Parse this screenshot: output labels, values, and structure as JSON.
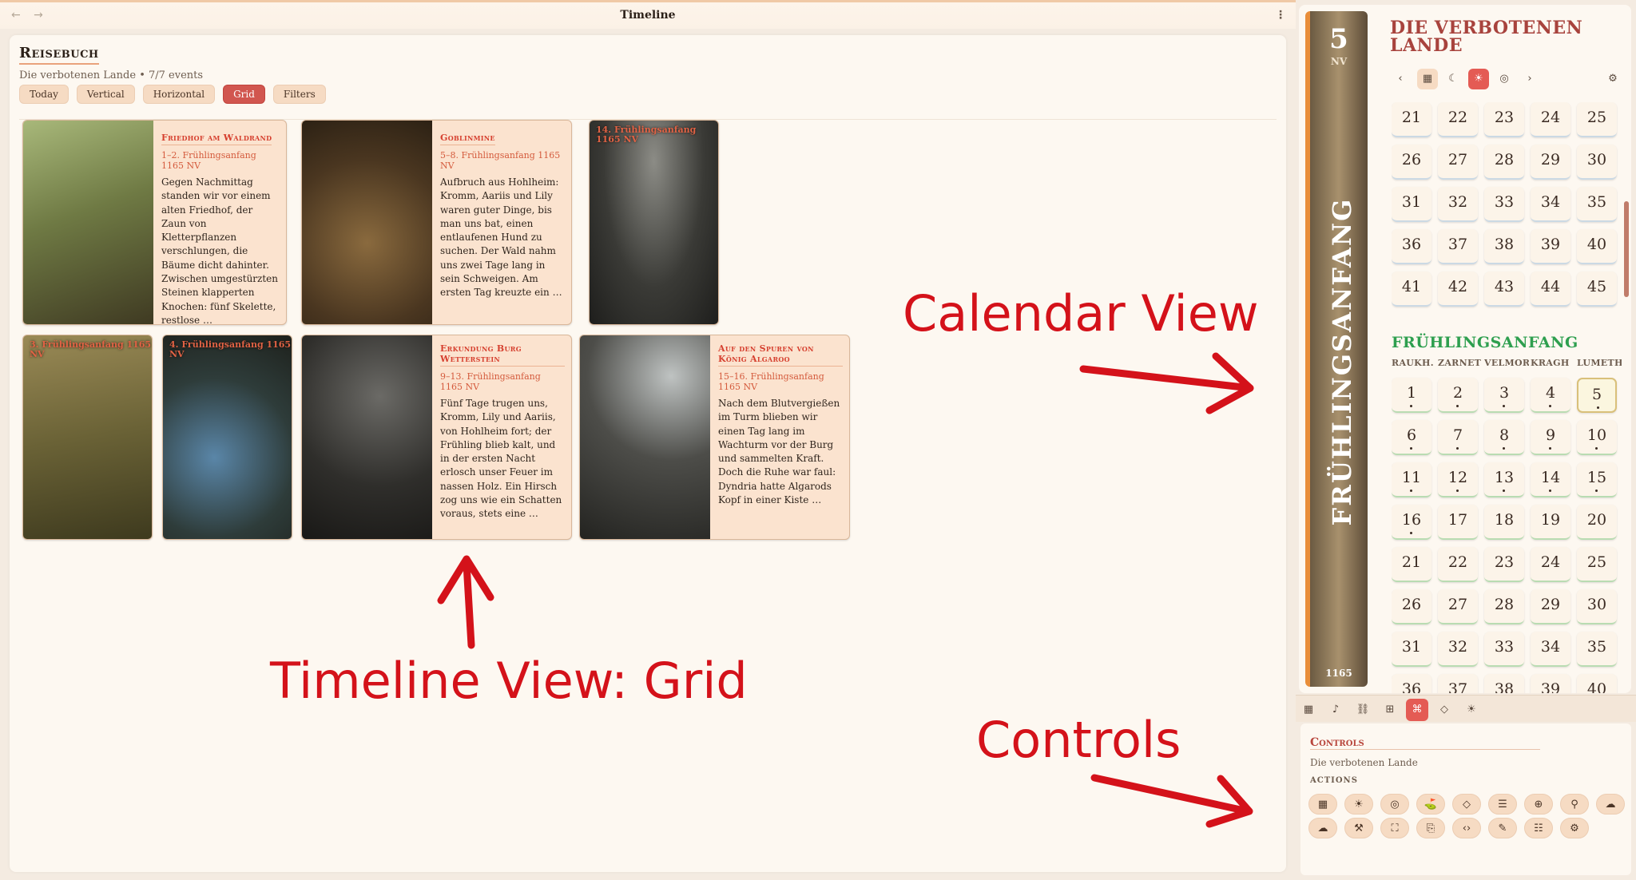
{
  "window": {
    "title": "Timeline",
    "nav": "← →",
    "more": "⋮"
  },
  "header": {
    "title": "Reisebuch",
    "subtitle": "Die verbotenen Lande • 7/7 events",
    "buttons": [
      "Today",
      "Vertical",
      "Horizontal",
      "Grid",
      "Filters"
    ],
    "active_button": "Grid"
  },
  "cards": [
    {
      "title": "Friedhof am Waldrand",
      "date": "1–2. Frühlingsanfang 1165 NV",
      "text": "Gegen Nachmittag standen wir vor einem alten Friedhof, der Zaun von Kletterpflanzen verschlungen, die Bäume dicht dahinter. Zwischen umgestürzten Steinen klapperten Knochen: fünf Skelette, restlose …"
    },
    {
      "title": "Goblinmine",
      "date": "5–8. Frühlingsanfang 1165 NV",
      "text": "Aufbruch aus Hohlheim: Kromm, Aariis und Lily waren guter Dinge, bis man uns bat, einen entlaufenen Hund zu suchen. Der Wald nahm uns zwei Tage lang in sein Schweigen. Am ersten Tag kreuzte ein …"
    },
    {
      "overlay": "14. Frühlingsanfang 1165 NV"
    },
    {
      "overlay": "3. Frühlingsanfang 1165 NV"
    },
    {
      "overlay": "4. Frühlingsanfang 1165 NV"
    },
    {
      "title": "Erkundung Burg Wetterstein",
      "date": "9–13. Frühlingsanfang 1165 NV",
      "text": "Fünf Tage trugen uns, Kromm, Lily und Aariis, von Hohlheim fort; der Frühling blieb kalt, und in der ersten Nacht erlosch unser Feuer im nassen Holz. Ein Hirsch zog uns wie ein Schatten voraus, stets eine …"
    },
    {
      "title": "Auf den Spuren von König Algaroo",
      "date": "15–16. Frühlingsanfang 1165 NV",
      "text": "Nach dem Blutvergießen im Turm blieben wir einen Tag lang im Wachturm vor der Burg und sammelten Kraft. Doch die Ruhe war faul: Dyndria hatte Algarods Kopf in einer Kiste …"
    }
  ],
  "annotations": {
    "calendar": "Calendar View",
    "timeline": "Timeline View: Grid",
    "controls": "Controls"
  },
  "calendar": {
    "spine_day": "5",
    "spine_era": "NV",
    "spine_season": "FRÜHLINGSANFANG",
    "spine_year": "1165",
    "title": "DIE VERBOTENEN LANDE",
    "tools": [
      "‹",
      "▦",
      "☾",
      "☀",
      "◎",
      "›",
      "⚙"
    ],
    "prev_weeks": [
      [
        21,
        22,
        23,
        24,
        25
      ],
      [
        26,
        27,
        28,
        29,
        30
      ],
      [
        31,
        32,
        33,
        34,
        35
      ],
      [
        36,
        37,
        38,
        39,
        40
      ],
      [
        41,
        42,
        43,
        44,
        45
      ]
    ],
    "month_name": "FRÜHLINGSANFANG",
    "weekdays": [
      "RAUKH.",
      "ZARNET",
      "VELMOR",
      "KRAGH",
      "LUMETH"
    ],
    "weeks": [
      [
        1,
        2,
        3,
        4,
        5
      ],
      [
        6,
        7,
        8,
        9,
        10
      ],
      [
        11,
        12,
        13,
        14,
        15
      ],
      [
        16,
        17,
        18,
        19,
        20
      ],
      [
        21,
        22,
        23,
        24,
        25
      ],
      [
        26,
        27,
        28,
        29,
        30
      ],
      [
        31,
        32,
        33,
        34,
        35
      ],
      [
        36,
        37,
        38,
        39,
        40
      ]
    ],
    "event_days": [
      1,
      2,
      3,
      4,
      5,
      6,
      7,
      8,
      9,
      10,
      11,
      12,
      13,
      14,
      15,
      16
    ],
    "selected_day": 5
  },
  "control_tabs": [
    "▦",
    "♪",
    "⛓",
    "⊞",
    "⌘",
    "◇",
    "☀"
  ],
  "active_control_tab": "⌘",
  "controls": {
    "title": "Controls",
    "subtitle": "Die verbotenen Lande",
    "actions_label": "ACTIONS",
    "actions_row1": [
      "▦",
      "☀",
      "◎",
      "⛳",
      "◇",
      "☰",
      "⊕",
      "⚲",
      "☁"
    ],
    "actions_row2": [
      "☁",
      "⚒",
      "⛶",
      "⎘",
      "‹›",
      "✎",
      "☷",
      "⚙"
    ]
  },
  "colors": {
    "accent": "#d1564f",
    "season": "#2e9f4f",
    "calendar_title": "#a8433d",
    "annotation": "#d4121a"
  }
}
